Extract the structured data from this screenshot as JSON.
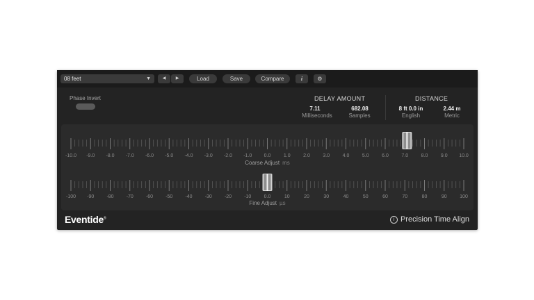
{
  "toolbar": {
    "preset_value": "08 feet",
    "prev_label": "◀",
    "next_label": "▶",
    "load_label": "Load",
    "save_label": "Save",
    "compare_label": "Compare",
    "info_label": "i",
    "settings_label": "⚙"
  },
  "phase_invert": {
    "label": "Phase Invert",
    "state": "off"
  },
  "delay": {
    "title": "DELAY AMOUNT",
    "ms_value": "7.11",
    "ms_label": "Milliseconds",
    "samples_value": "682.08",
    "samples_label": "Samples"
  },
  "distance": {
    "title": "DISTANCE",
    "english_value": "8 ft 0.0 in",
    "english_label": "English",
    "metric_value": "2.44 m",
    "metric_label": "Metric"
  },
  "coarse": {
    "label": "Coarse Adjust",
    "unit": "ms",
    "min": -10,
    "max": 10,
    "value": 7.11,
    "ticks": [
      "-10.0",
      "-9.0",
      "-8.0",
      "-7.0",
      "-6.0",
      "-5.0",
      "-4.0",
      "-3.0",
      "-2.0",
      "-1.0",
      "0.0",
      "1.0",
      "2.0",
      "3.0",
      "4.0",
      "5.0",
      "6.0",
      "7.0",
      "8.0",
      "9.0",
      "10.0"
    ]
  },
  "fine": {
    "label": "Fine Adjust",
    "unit": "µs",
    "min": -100,
    "max": 100,
    "value": 0,
    "ticks": [
      "-100",
      "-90",
      "-80",
      "-70",
      "-60",
      "-50",
      "-40",
      "-30",
      "-20",
      "-10",
      "0.0",
      "10",
      "20",
      "30",
      "40",
      "50",
      "60",
      "70",
      "80",
      "90",
      "100"
    ]
  },
  "footer": {
    "logo": "Eventide",
    "logo_mark": "®",
    "product": "Precision Time Align",
    "product_icon": "info-circle-icon"
  }
}
